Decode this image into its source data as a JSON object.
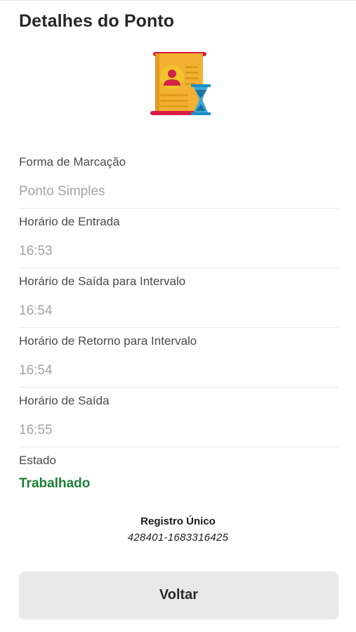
{
  "header": {
    "title": "Detalhes do Ponto"
  },
  "illustration": {
    "icon": "timesheet-scroll-hourglass-icon"
  },
  "fields": [
    {
      "label": "Forma de Marcação",
      "value": "Ponto Simples"
    },
    {
      "label": "Horário de Entrada",
      "value": "16:53"
    },
    {
      "label": "Horário de Saída para Intervalo",
      "value": "16:54"
    },
    {
      "label": "Horário de Retorno para Intervalo",
      "value": "16:54"
    },
    {
      "label": "Horário de Saída",
      "value": "16:55"
    }
  ],
  "status": {
    "label": "Estado",
    "value": "Trabalhado",
    "color": "#1e7d34"
  },
  "registro": {
    "label": "Registro Único",
    "value": "428401-1683316425"
  },
  "actions": {
    "back_label": "Voltar"
  },
  "colors": {
    "scroll": "#f2b132",
    "scroll_dark": "#e09a1c",
    "scroll_rod": "#d81b45",
    "avatar_bg": "#f0c42a",
    "avatar_body": "#d32346",
    "hourglass": "#1e8fc4",
    "text_primary": "#262626",
    "text_muted": "#a3a3a3",
    "button_bg": "#e9e9e9"
  }
}
